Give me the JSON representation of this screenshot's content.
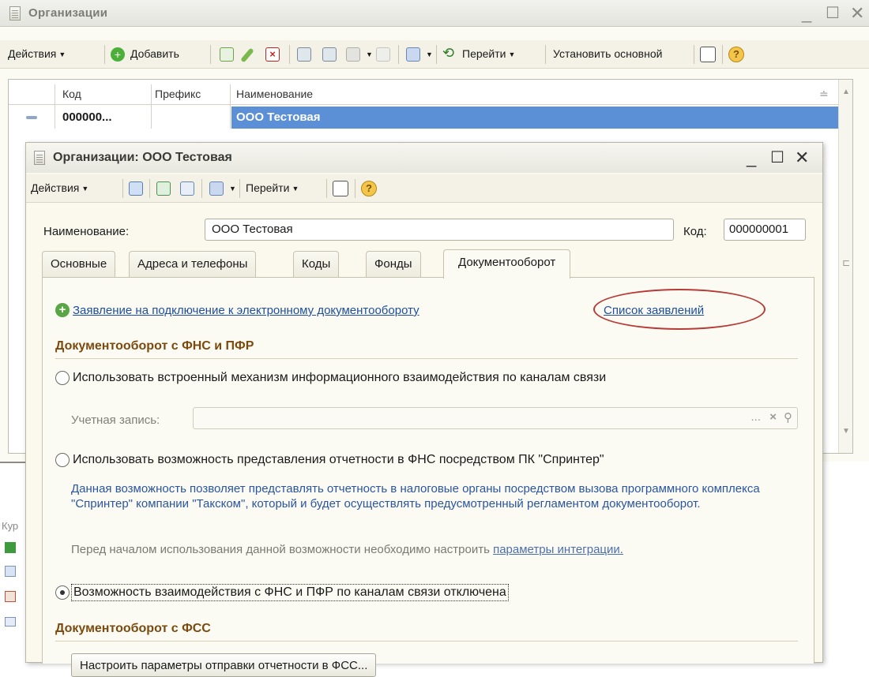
{
  "outer": {
    "title": "Организации",
    "toolbar": {
      "actions": "Действия",
      "add": "Добавить",
      "goto": "Перейти",
      "set_main": "Установить основной"
    },
    "columns": [
      "Код",
      "Префикс",
      "Наименование"
    ],
    "row": {
      "code": "000000...",
      "prefix": "",
      "name": "ООО Тестовая"
    },
    "left_text": "Кур"
  },
  "inner": {
    "title": "Организации: ООО Тестовая",
    "toolbar": {
      "actions": "Действия",
      "goto": "Перейти"
    },
    "name_label": "Наименование:",
    "name_value": "ООО Тестовая",
    "code_label": "Код:",
    "code_value": "000000001",
    "tabs": [
      "Основные",
      "Адреса и телефоны",
      "Коды",
      "Фонды",
      "Документооборот"
    ],
    "active_tab": "Документооборот",
    "app_link": "Заявление на подключение к электронному документообороту",
    "list_link": "Список заявлений",
    "section1": "Документооборот с ФНС и ПФР",
    "radio1": "Использовать встроенный механизм информационного взаимодействия по каналам связи",
    "account_label": "Учетная запись:",
    "account_value": "",
    "account_btn": "...",
    "radio2": "Использовать возможность представления отчетности в ФНС посредством ПК \"Спринтер\"",
    "note": "Данная возможность позволяет представлять отчетность в налоговые органы посредством вызова программного комплекса \"Спринтер\" компании \"Такском\", который и будет осуществлять предусмотренный регламентом документооборот.",
    "note2": "Перед началом использования данной возможности необходимо настроить",
    "note2_link": "параметры интеграции.",
    "radio3": "Возможность взаимодействия с ФНС и ПФР по каналам связи отключена",
    "radio3_selected": true,
    "section2": "Документооборот с ФСС",
    "fss_button": "Настроить параметры отправки отчетности в ФСС..."
  },
  "colors": {
    "selection": "#5b8fd6",
    "link": "#1e4e9c",
    "section": "#7a4a0f",
    "highlight_ellipse": "#b83a36"
  }
}
